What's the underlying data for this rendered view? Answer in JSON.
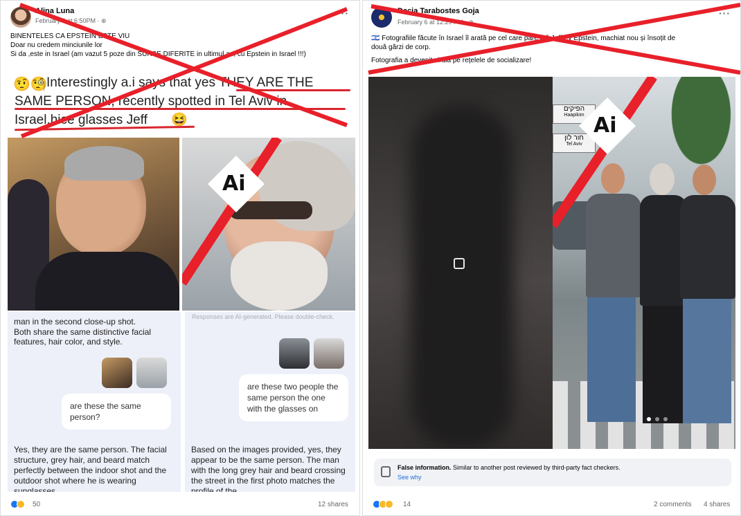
{
  "left_post": {
    "author": "Alina Luna",
    "meta": "February 6 at 6:50PM · ",
    "caption_lines": [
      "BINENTELES CA EPSTEIN ESTE VIU",
      "Doar nu credem minciunile lor",
      "Si da ,este in Israel  (am vazut 5 poze din SURSE DIFERITE in ultimul an, cu Epstein in Israel !!!)"
    ],
    "headline": "Interestingly a.i says that yes THEY ARE THE SAME PERSON, recently spotted in Tel Aviv in Israel,hice glasses Jeff",
    "headline_lines": [
      "Interestingly a.i says that yes THEY ARE THE",
      "SAME PERSON, recently spotted in Tel Aviv in",
      "Israel,hice glasses Jeff"
    ],
    "ai_label": "Ai",
    "chat_left": {
      "top_text_1": "man in the second close-up shot.",
      "top_text_2": "Both share the same distinctive facial",
      "top_text_3": "features, hair color, and style.",
      "question": "are these the same person?",
      "answer": "Yes, they are the same person. The facial structure, grey hair, and beard match perfectly between the indoor shot and the outdoor shot where he is wearing sunglasses."
    },
    "chat_right": {
      "disclaimer": "Responses are AI-generated. Please double-check.",
      "question": "are these two people the same person the one with the glasses on",
      "answer": "Based on the images provided, yes, they appear to be the same person. The man with the long grey hair and beard crossing the street in the first photo matches the profile of the"
    },
    "reactions_count": "50",
    "shares": "12 shares"
  },
  "right_post": {
    "author": "Dacia Tarabostes Goja",
    "meta": "February 6 at 12:29 PM · ",
    "caption_line_1": "Fotografiile făcute în Israel îl arată pe cel care pare a fi Jeffrey Epstein, machiat nou și însoțit de",
    "caption_line_2": "două gărzi de corp.",
    "caption_line_3": "Fotografia a devenit virală pe rețelele de socializare!",
    "ai_label": "Ai",
    "street_sign_1": "הפיקים",
    "street_sign_2": "Haapikim",
    "street_sign_3": "חור לון",
    "street_sign_4": "Tel Aviv",
    "fact_check_title": "False information.",
    "fact_check_text": " Similar to another post reviewed by third-party fact checkers.",
    "fact_check_link": "See why",
    "reactions_count": "14",
    "comments": "2 comments",
    "shares": "4 shares"
  },
  "colors": {
    "x_red": "#e8202a",
    "fb_link": "#216fdb",
    "underline_red": "#d9262e"
  }
}
